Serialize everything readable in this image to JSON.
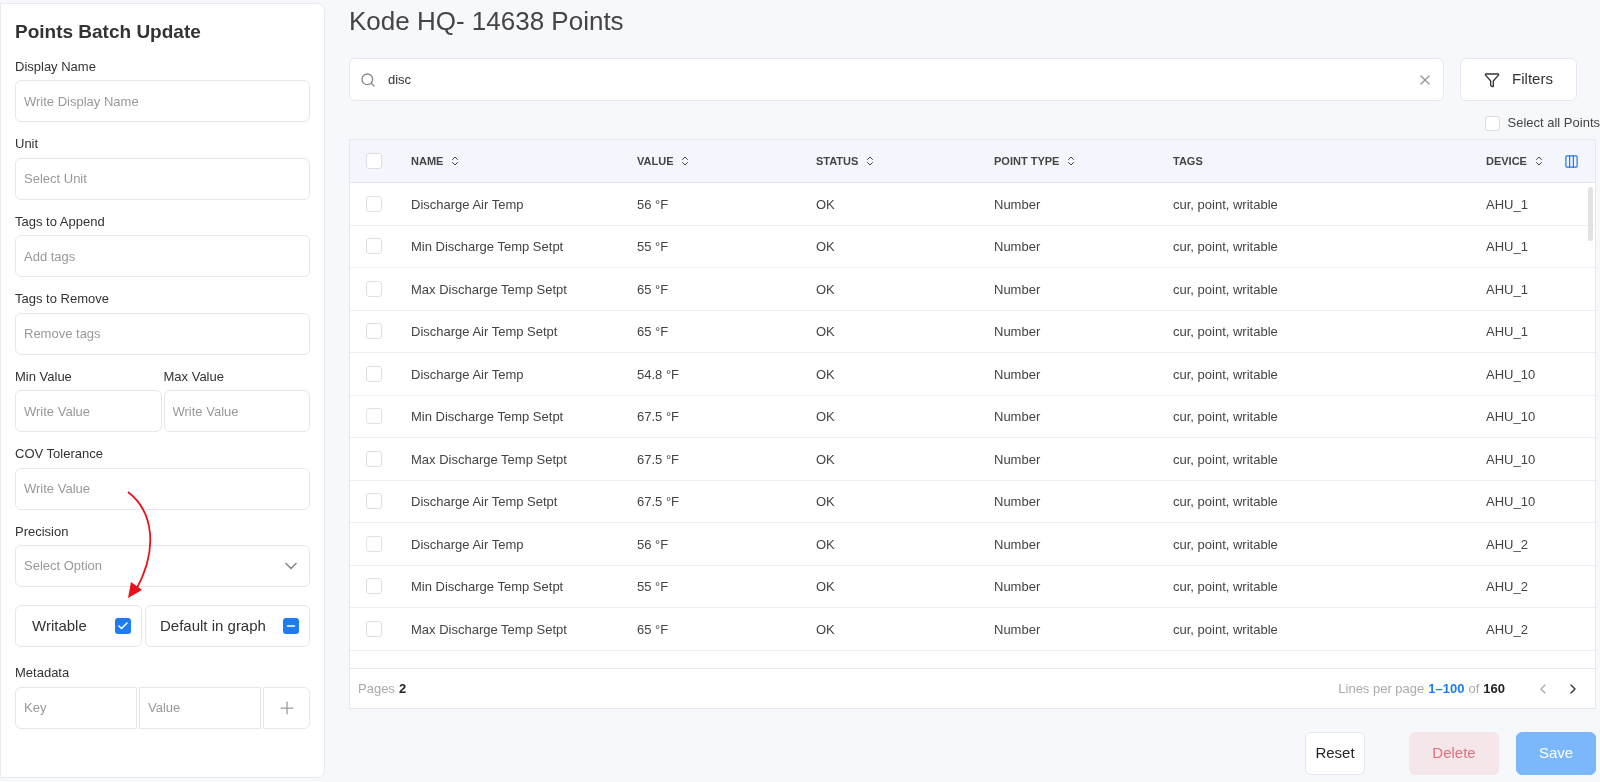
{
  "sidebar": {
    "title": "Points Batch Update",
    "fields": [
      {
        "label": "Display Name",
        "placeholder": "Write Display Name"
      },
      {
        "label": "Unit",
        "placeholder": "Select Unit"
      },
      {
        "label": "Tags to Append",
        "placeholder": "Add tags"
      },
      {
        "label": "Tags to Remove",
        "placeholder": "Remove tags"
      }
    ],
    "range": [
      {
        "label": "Min Value",
        "placeholder": "Write Value"
      },
      {
        "label": "Max Value",
        "placeholder": "Write Value"
      }
    ],
    "cov": {
      "label": "COV Tolerance",
      "placeholder": "Write Value"
    },
    "precision": {
      "label": "Precision",
      "placeholder": "Select Option"
    },
    "toggles": [
      {
        "label": "Writable",
        "checked": true
      },
      {
        "label": "Default in graph",
        "indeterminate": true
      }
    ],
    "metadata": {
      "label": "Metadata",
      "key_placeholder": "Key",
      "value_placeholder": "Value"
    }
  },
  "title": "Kode HQ- 14638 Points",
  "search": {
    "value": "disc"
  },
  "filters_button": "Filters",
  "select_all": {
    "label": "Select all Points",
    "checked": false
  },
  "table": {
    "all_checked": false,
    "columns": [
      {
        "label": "NAME",
        "sortable": true
      },
      {
        "label": "VALUE",
        "sortable": true
      },
      {
        "label": "STATUS",
        "sortable": true
      },
      {
        "label": "POINT TYPE",
        "sortable": true
      },
      {
        "label": "TAGS",
        "sortable": false
      },
      {
        "label": "DEVICE",
        "sortable": true
      }
    ],
    "rows": [
      {
        "selected": false,
        "cells": [
          "Discharge Air Temp",
          "56 °F",
          "OK",
          "Number",
          "cur, point, writable",
          "AHU_1"
        ]
      },
      {
        "selected": false,
        "cells": [
          "Min Discharge Temp Setpt",
          "55 °F",
          "OK",
          "Number",
          "cur, point, writable",
          "AHU_1"
        ]
      },
      {
        "selected": false,
        "cells": [
          "Max Discharge Temp Setpt",
          "65 °F",
          "OK",
          "Number",
          "cur, point, writable",
          "AHU_1"
        ]
      },
      {
        "selected": false,
        "cells": [
          "Discharge Air Temp Setpt",
          "65 °F",
          "OK",
          "Number",
          "cur, point, writable",
          "AHU_1"
        ]
      },
      {
        "selected": false,
        "cells": [
          "Discharge Air Temp",
          "54.8 °F",
          "OK",
          "Number",
          "cur, point, writable",
          "AHU_10"
        ]
      },
      {
        "selected": false,
        "cells": [
          "Min Discharge Temp Setpt",
          "67.5 °F",
          "OK",
          "Number",
          "cur, point, writable",
          "AHU_10"
        ]
      },
      {
        "selected": false,
        "cells": [
          "Max Discharge Temp Setpt",
          "67.5 °F",
          "OK",
          "Number",
          "cur, point, writable",
          "AHU_10"
        ]
      },
      {
        "selected": false,
        "cells": [
          "Discharge Air Temp Setpt",
          "67.5 °F",
          "OK",
          "Number",
          "cur, point, writable",
          "AHU_10"
        ]
      },
      {
        "selected": false,
        "cells": [
          "Discharge Air Temp",
          "56 °F",
          "OK",
          "Number",
          "cur, point, writable",
          "AHU_2"
        ]
      },
      {
        "selected": false,
        "cells": [
          "Min Discharge Temp Setpt",
          "55 °F",
          "OK",
          "Number",
          "cur, point, writable",
          "AHU_2"
        ]
      },
      {
        "selected": false,
        "cells": [
          "Max Discharge Temp Setpt",
          "65 °F",
          "OK",
          "Number",
          "cur, point, writable",
          "AHU_2"
        ]
      }
    ]
  },
  "footer": {
    "pages_label": "Pages",
    "pages": "2",
    "lines_label": "Lines per page",
    "range": "1–100",
    "of": "of",
    "total": "160"
  },
  "actions": [
    {
      "label": "Reset",
      "kind": "secondary",
      "disabled": false
    },
    {
      "label": "Delete",
      "kind": "danger",
      "disabled": true
    },
    {
      "label": "Save",
      "kind": "primary",
      "disabled": true
    }
  ]
}
